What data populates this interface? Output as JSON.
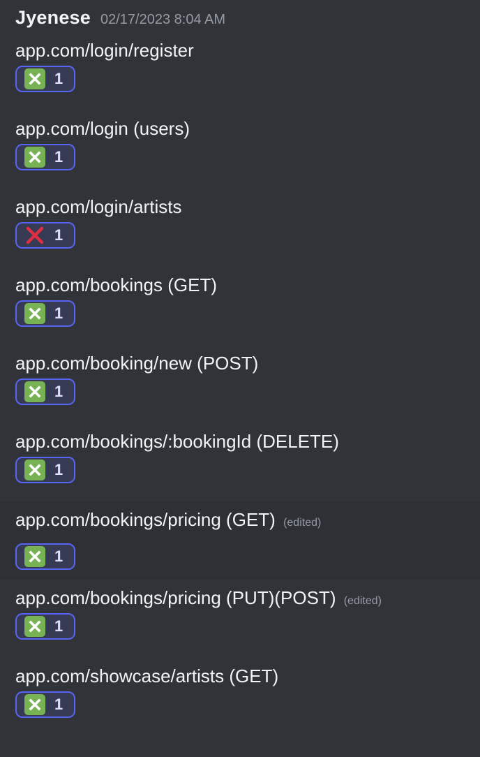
{
  "message": {
    "username": "Jyenese",
    "timestamp": "02/17/2023 8:04 AM",
    "accent_color": "#5865f2",
    "lines": [
      {
        "text": "app.com/login/register",
        "edited": "",
        "reaction": {
          "emoji": "negative-squared-cross-mark",
          "color": "#77b255",
          "count": "1"
        }
      },
      {
        "text": "app.com/login (users)",
        "edited": "",
        "reaction": {
          "emoji": "negative-squared-cross-mark",
          "color": "#77b255",
          "count": "1"
        }
      },
      {
        "text": "app.com/login/artists",
        "edited": "",
        "reaction": {
          "emoji": "cross-mark",
          "color": "#dd2e44",
          "count": "1"
        }
      },
      {
        "text": "app.com/bookings (GET)",
        "edited": "",
        "reaction": {
          "emoji": "negative-squared-cross-mark",
          "color": "#77b255",
          "count": "1"
        }
      },
      {
        "text": "app.com/booking/new (POST)",
        "edited": "",
        "reaction": {
          "emoji": "negative-squared-cross-mark",
          "color": "#77b255",
          "count": "1"
        }
      },
      {
        "text": "app.com/bookings/:bookingId (DELETE)",
        "edited": "",
        "reaction": {
          "emoji": "negative-squared-cross-mark",
          "color": "#77b255",
          "count": "1"
        }
      },
      {
        "text": "app.com/bookings/pricing (GET)",
        "edited": "(edited)",
        "reaction": {
          "emoji": "negative-squared-cross-mark",
          "color": "#77b255",
          "count": "1"
        }
      },
      {
        "text": "app.com/bookings/pricing (PUT)(POST)",
        "edited": "(edited)",
        "reaction": {
          "emoji": "negative-squared-cross-mark",
          "color": "#77b255",
          "count": "1"
        }
      },
      {
        "text": "app.com/showcase/artists (GET)",
        "edited": "",
        "reaction": {
          "emoji": "negative-squared-cross-mark",
          "color": "#77b255",
          "count": "1"
        }
      }
    ]
  }
}
